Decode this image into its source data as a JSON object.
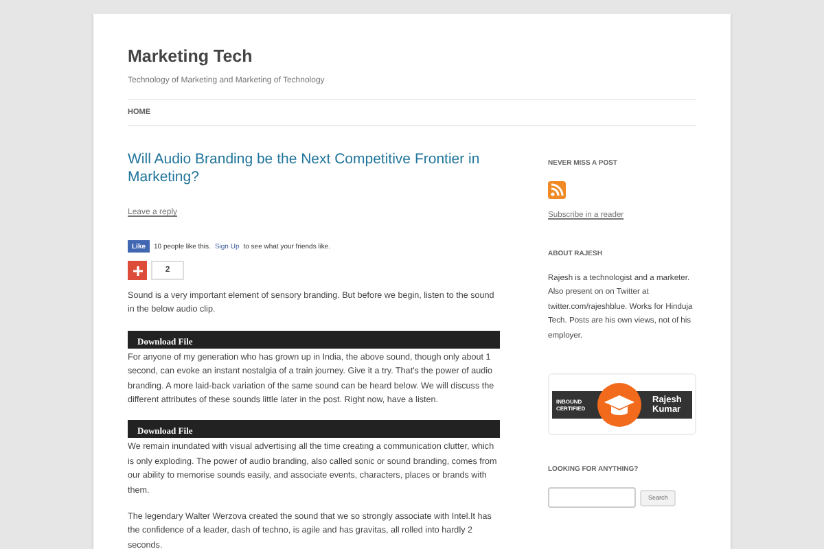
{
  "site": {
    "title": "Marketing Tech",
    "tagline": "Technology of Marketing and Marketing of Technology"
  },
  "nav": [
    {
      "label": "HOME"
    }
  ],
  "post": {
    "title": "Will Audio Branding be the Next Competitive Frontier in Marketing?",
    "reply_link": "Leave a reply",
    "like": {
      "button": "Like",
      "text_before": "10 people like this.",
      "link": "Sign Up",
      "text_after": "to see what your friends like."
    },
    "plus": {
      "count": "2"
    },
    "blocks": [
      {
        "kind": "para",
        "text": "Sound is a very important element of sensory branding. But before we begin, listen to the sound in the below audio clip."
      },
      {
        "kind": "download",
        "text": "Download File"
      },
      {
        "kind": "para",
        "text": "For anyone of my generation who has grown up in India, the above sound, though only about 1 second, can evoke an instant nostalgia of a train journey. Give it a try. That's the power of audio branding. A more laid-back variation of the same sound can be heard below. We will discuss the different attributes of these sounds little later in the post. Right now, have a listen."
      },
      {
        "kind": "download",
        "text": "Download File"
      },
      {
        "kind": "para",
        "text": "We remain inundated with visual advertising all the time creating a communication clutter, which is only exploding. The power of audio branding, also called sonic or sound branding, comes from our ability to memorise sounds easily, and associate events, characters, places or brands with them."
      },
      {
        "kind": "para",
        "text": "The legendary Walter Werzova created the sound that we so strongly associate with Intel.It has the confidence of a leader, dash of techno, is agile and has gravitas, all rolled into hardly 2 seconds."
      }
    ]
  },
  "sidebar": [
    {
      "kind": "subscribe",
      "heading": "NEVER MISS A POST",
      "link": "Subscribe in a reader"
    },
    {
      "kind": "text",
      "heading": "ABOUT RAJESH",
      "text": "Rajesh is a technologist and a marketer. Also present on on Twitter at twitter.com/rajeshblue. Works for Hinduja Tech. Posts are his own views, not of his employer."
    },
    {
      "kind": "badge",
      "left": "INBOUND CERTIFIED",
      "right": "Rajesh Kumar"
    },
    {
      "kind": "search",
      "heading": "LOOKING FOR ANYTHING?",
      "button": "Search"
    }
  ]
}
